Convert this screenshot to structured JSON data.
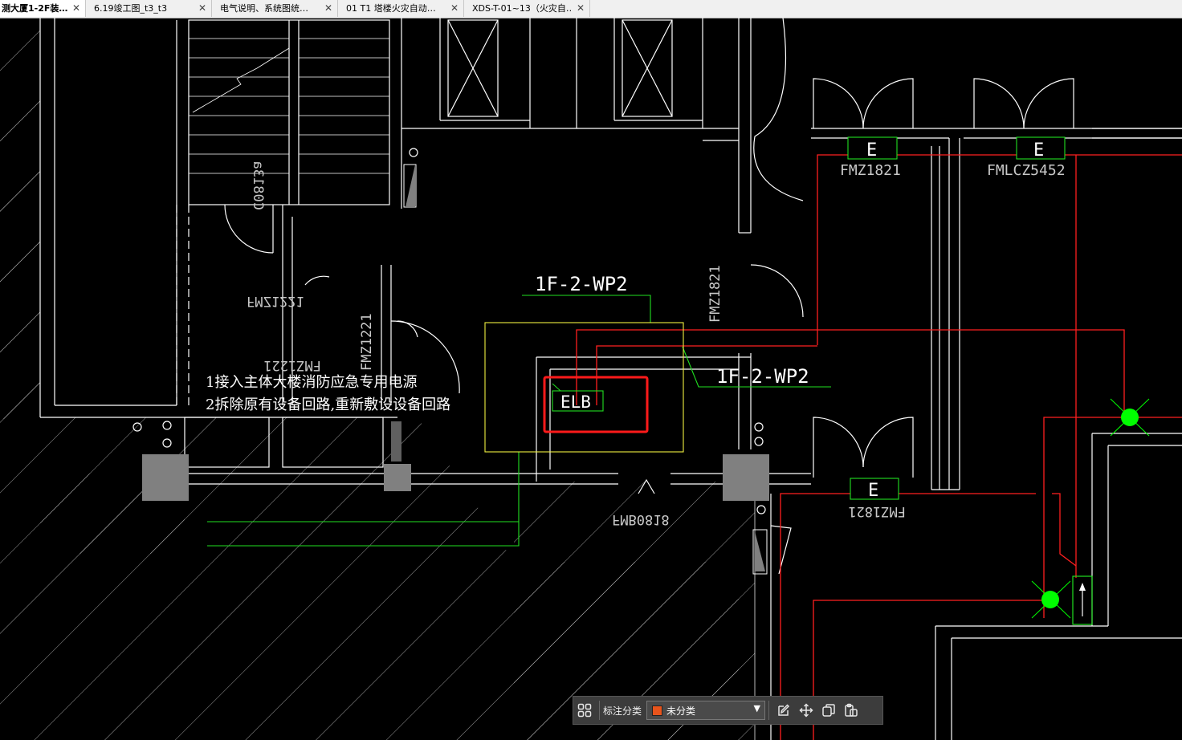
{
  "tabs": [
    {
      "label": "测大厦1-2F装…",
      "active": true
    },
    {
      "label": "6.19竣工图_t3_t3",
      "active": false
    },
    {
      "label": "电气说明、系统图统…",
      "active": false
    },
    {
      "label": "01 T1 塔楼火灾自动…",
      "active": false
    },
    {
      "label": "XDS-T-01~13（火灾自…",
      "active": false
    }
  ],
  "drawing": {
    "labels": {
      "wp2_upper": "1F-2-WP2",
      "wp2_lower": "1F-2-WP2",
      "elb": "ELB",
      "exit_sign": "E",
      "door_fmz1821_top": "FMZ1821",
      "door_fmlcz5452": "FMLCZ5452",
      "door_fmz1821_bottom": "FMZ1821",
      "door_fmz1821_vertical": "FMZ1821",
      "door_fmz1221_left": "FMZ1221",
      "door_fmz1221_mirror": "FMZ1221",
      "door_fmz1221_vertical": "FMZ1221",
      "window_c0813a": "C0813a",
      "door_fmb0818": "FMB0818"
    },
    "notes": [
      "1接入主体大楼消防应急专用电源",
      "2拆除原有设备回路,重新敷设设备回路"
    ],
    "colors": {
      "background": "#000000",
      "wall": "#ffffff",
      "red_circuit": "#ff2020",
      "green_circuit": "#20e020",
      "yellow_box": "#f0f040",
      "highlight": "#ff1a1a",
      "column": "#808080",
      "lamp": "#00ff00"
    }
  },
  "toolbar": {
    "category_label": "标注分类",
    "selected_category": "未分类",
    "selected_color": "#e8541c",
    "icons": [
      "grid-icon",
      "edit-icon",
      "move-icon",
      "copy-icon",
      "paste-icon"
    ]
  }
}
